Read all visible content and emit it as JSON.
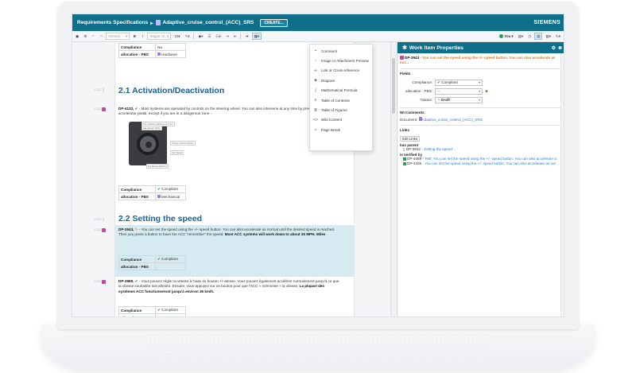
{
  "header": {
    "breadcrumb_root": "Requirements Specifications",
    "breadcrumb_sep": "▸",
    "doc_name": "Adaptive_cruise_control_(ACC)_SRS",
    "create_label": "CREATE...",
    "brand": "SIEMENS"
  },
  "toolbar": {
    "normal": "Normal",
    "font": "Segoe UI",
    "size": "10",
    "user": "You"
  },
  "insert_menu": {
    "items": [
      {
        "icon": "comment-icon",
        "glyph": "▪",
        "label": "Comment"
      },
      {
        "icon": "image-icon",
        "glyph": "▫",
        "label": "Image or Attachment Preview"
      },
      {
        "icon": "link-icon",
        "glyph": "∞",
        "label": "Link or Cross-reference"
      },
      {
        "icon": "diagram-icon",
        "glyph": "◈",
        "label": "Diagram"
      },
      {
        "icon": "formula-icon",
        "glyph": "∫",
        "label": "Mathematical Formula"
      },
      {
        "icon": "toc-icon",
        "glyph": "≡",
        "label": "Table of Contents"
      },
      {
        "icon": "figures-icon",
        "glyph": "≣",
        "label": "Table of Figures"
      },
      {
        "icon": "wiki-icon",
        "glyph": "<>",
        "label": "Wiki Content"
      },
      {
        "icon": "page-break-icon",
        "glyph": "⤶",
        "label": "Page Break"
      }
    ]
  },
  "document": {
    "top_table": [
      {
        "key": "Compliance",
        "value": "Na"
      },
      {
        "key": "allocation - PBS",
        "value": "Hardware"
      }
    ],
    "section1_title": "2.1 Activation/Deactivation",
    "dp4132_id": "DP-4132,",
    "dp4132_text": "- Most systems are operated by controls on the steering wheel. You can also intervene at any time by pressing the brake or accelerator pedal, except if you are in a dangerous zone",
    "fig_labels": {
      "a": "The Following Buttons Are Set",
      "b": "Set Speed Up/Dn",
      "c": "Cruise Control System",
      "d": "Set Speed",
      "e": "Set Resume/Button"
    },
    "mid_table": [
      {
        "key": "Compliance",
        "value": "Compliant"
      },
      {
        "key": "allocation - PBS",
        "value": "Mechanical"
      }
    ],
    "section2_title": "2.2 Setting the speed",
    "dp3943_id": "DP-3943,",
    "dp3943_text": "- You can set the speed using the +/- speed button. You can also accelerate as normal until the desired speed is reached. Then you press a button to have the ACC \"remember\" the speed.",
    "dp3943_bold": "Most ACC systems will work down to about 25 MPH. Miles",
    "hl_table": [
      {
        "key": "Compliance",
        "value": "Compliant"
      },
      {
        "key": "allocation - PBS",
        "value": ""
      }
    ],
    "dp3989_id": "DP-3989,",
    "dp3989_text": "- Vous pouvez régler la vitesse à l'aide du bouton +/-vitesse. Vous pouvez également accélérer normalement jusqu'à ce que la vitesse souhaitée soit atteinte. Ensuite, vous appuyez sur un bouton pour que l'ACC « mémorise » la vitesse.",
    "dp3989_bold": "La plupart des systèmes ACC fonctionneront jusqu'à environ 35 km/h.",
    "bottom_table": [
      {
        "key": "Compliance",
        "value": "Compliant"
      },
      {
        "key": "allocation - PBS",
        "value": ""
      }
    ]
  },
  "panel": {
    "title": "Work Item Properties",
    "item_id": "DP-3943",
    "item_text": "- You can set the speed using the +/- speed button. You can also accelerate as nor...",
    "fields_label": "Fields",
    "compliance_label": "Compliance:",
    "compliance_value": "Compliant",
    "allocation_label": "allocation - PBS:",
    "allocation_value": "--",
    "status_label": "*Status:",
    "status_value": "Draft",
    "comments_label": "WI Comments",
    "document_label": "Document:",
    "document_value": "Adaptive_cruise_control_(ACC)_SRS",
    "links_label": "Links",
    "edit_links": "Edit Links",
    "has_parent": "has parent",
    "parent_id": "DP-3942",
    "parent_text": "- Setting the speed",
    "verified_by": "is verified by",
    "v1_id": "DP-4089",
    "v1_text": "- Test: You can set the speed using the +/- speed button. You can also accelerate a",
    "v2_id": "DP-4205",
    "v2_text": "- You can set the speed using the +/- speed button. You can also accelerate as nor"
  },
  "colors": {
    "brand_teal": "#0f6e8a",
    "heading_blue": "#1d5f93",
    "highlight": "#d5eaf1",
    "orange": "#e07b1a",
    "green": "#2e9b5a"
  }
}
